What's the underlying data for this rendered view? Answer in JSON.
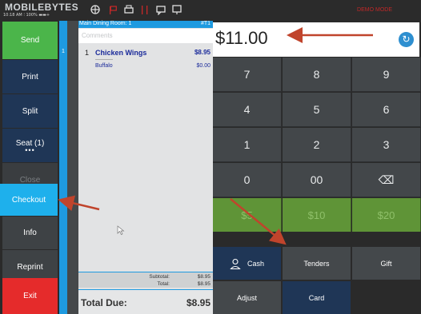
{
  "topbar": {
    "logo": "MOBILEBYTES",
    "status": "10:18 AM ⁝ 100% ▬▬+",
    "demo_mode": "DEMO MODE"
  },
  "left_buttons": {
    "send": "Send",
    "print": "Print",
    "split": "Split",
    "seat": "Seat (1)",
    "seat_dots": "•••",
    "close": "Close",
    "checkout": "Checkout",
    "info": "Info",
    "reprint": "Reprint",
    "exit": "Exit"
  },
  "seat_strip": {
    "seat_number": "1"
  },
  "ticket": {
    "room": "Main Dining Room: 1",
    "ticket_number": "#T1",
    "comments_placeholder": "Comments",
    "items": [
      {
        "qty": "1",
        "name": "Chicken Wings",
        "price": "$8.95",
        "separator": "-----------",
        "modifier": "Buffalo",
        "modifier_price": "$0.00"
      }
    ],
    "subtotal_label": "Subtotal:",
    "subtotal": "$8.95",
    "total_label": "Total:",
    "total": "$8.95",
    "total_due_label": "Total Due:",
    "total_due": "$8.95"
  },
  "payment": {
    "amount": "$11.00",
    "keys": [
      "7",
      "8",
      "9",
      "4",
      "5",
      "6",
      "1",
      "2",
      "3",
      "0",
      "00",
      "⌫"
    ],
    "quick_amounts": [
      "$5",
      "$10",
      "$20"
    ],
    "tenders": {
      "cash": "Cash",
      "tenders": "Tenders",
      "gift": "Gift",
      "adjust": "Adjust",
      "card": "Card"
    }
  },
  "colors": {
    "send_green": "#4bb54a",
    "checkout_blue": "#1eb0ec",
    "exit_red": "#e52b2b",
    "button_navy": "#1f3656",
    "arrow_red": "#c0442c",
    "quick_green": "#5f9437"
  }
}
